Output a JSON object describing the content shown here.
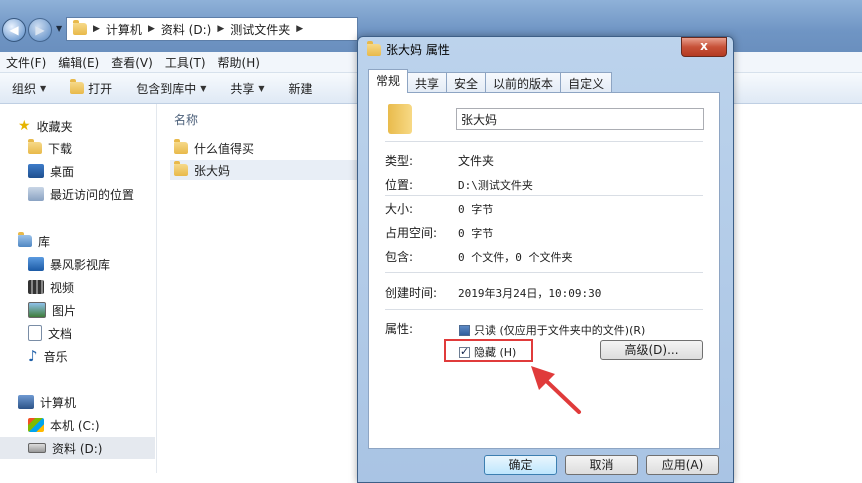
{
  "explorer": {
    "breadcrumbs": [
      "计算机",
      "资料 (D:)",
      "测试文件夹"
    ],
    "menu": [
      "文件(F)",
      "编辑(E)",
      "查看(V)",
      "工具(T)",
      "帮助(H)"
    ],
    "toolbar": {
      "organize": "组织",
      "open": "打开",
      "include_library": "包含到库中",
      "share": "共享",
      "new_folder": "新建"
    },
    "nav": {
      "favorites": "收藏夹",
      "downloads": "下载",
      "desktop": "桌面",
      "recent": "最近访问的位置",
      "libraries": "库",
      "storm_video": "暴风影视库",
      "videos": "视频",
      "pictures": "图片",
      "documents": "文档",
      "music": "音乐",
      "computer": "计算机",
      "drive_c": "本机 (C:)",
      "drive_d": "资料 (D:)"
    },
    "column_name": "名称",
    "files": [
      "什么值得买",
      "张大妈"
    ]
  },
  "dialog": {
    "title": "张大妈 属性",
    "close": "x",
    "tabs": [
      "常规",
      "共享",
      "安全",
      "以前的版本",
      "自定义"
    ],
    "name_value": "张大妈",
    "fields": {
      "type_label": "类型:",
      "type_value": "文件夹",
      "location_label": "位置:",
      "location_value": "D:\\测试文件夹",
      "size_label": "大小:",
      "size_value": "0 字节",
      "size_on_disk_label": "占用空间:",
      "size_on_disk_value": "0 字节",
      "contains_label": "包含:",
      "contains_value": "0 个文件，0 个文件夹",
      "created_label": "创建时间:",
      "created_value": "2019年3月24日，10:09:30",
      "attributes_label": "属性:"
    },
    "readonly_label": "只读 (仅应用于文件夹中的文件)(R)",
    "readonly_state": "indeterminate",
    "hidden_label": "隐藏 (H)",
    "hidden_state": "checked",
    "advanced_button": "高级(D)...",
    "ok_button": "确定",
    "cancel_button": "取消",
    "apply_button": "应用(A)",
    "highlight_color": "#e03b3b"
  }
}
